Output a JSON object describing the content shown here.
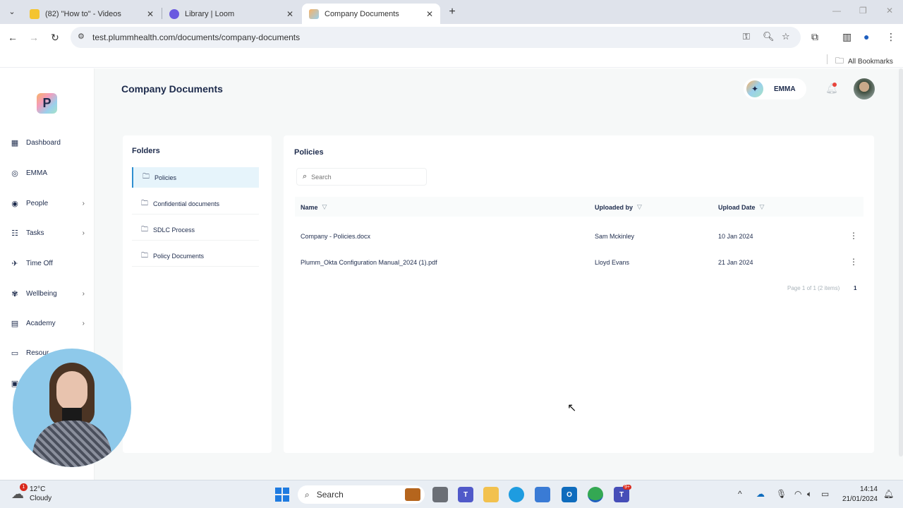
{
  "browser": {
    "tabs": [
      {
        "title": "(82) \"How to\" - Videos"
      },
      {
        "title": "Library | Loom"
      },
      {
        "title": "Company Documents"
      }
    ],
    "url": "test.plummhealth.com/documents/company-documents",
    "bookmarks_label": "All Bookmarks"
  },
  "sidebar": {
    "logo": "P",
    "items": [
      {
        "label": "Dashboard",
        "icon": "dashboard-icon"
      },
      {
        "label": "EMMA",
        "icon": "emma-icon"
      },
      {
        "label": "People",
        "icon": "people-icon"
      },
      {
        "label": "Tasks",
        "icon": "tasks-icon"
      },
      {
        "label": "Time Off",
        "icon": "plane-icon"
      },
      {
        "label": "Wellbeing",
        "icon": "wellbeing-icon"
      },
      {
        "label": "Academy",
        "icon": "academy-icon"
      },
      {
        "label": "Resour",
        "icon": "resources-icon"
      }
    ]
  },
  "header": {
    "title": "Company Documents",
    "assistant_label": "EMMA"
  },
  "folders": {
    "heading": "Folders",
    "items": [
      {
        "label": "Policies"
      },
      {
        "label": "Confidential documents"
      },
      {
        "label": "SDLC Process"
      },
      {
        "label": "Policy Documents"
      }
    ]
  },
  "documents": {
    "heading": "Policies",
    "search_placeholder": "Search",
    "columns": {
      "name": "Name",
      "uploaded_by": "Uploaded by",
      "upload_date": "Upload Date"
    },
    "rows": [
      {
        "name": "Company - Policies.docx",
        "uploaded_by": "Sam Mckinley",
        "upload_date": "10 Jan 2024"
      },
      {
        "name": "Plumm_Okta Configuration Manual_2024 (1).pdf",
        "uploaded_by": "Lloyd Evans",
        "upload_date": "21 Jan 2024"
      }
    ],
    "pagination_text": "Page 1 of 1 (2 items)",
    "current_page": "1"
  },
  "taskbar": {
    "weather_temp": "12°C",
    "weather_desc": "Cloudy",
    "weather_badge": "1",
    "search_label": "Search",
    "teams_badge": "9+",
    "time": "14:14",
    "date": "21/01/2024"
  },
  "colors": {
    "accent": "#2f8fd0",
    "text": "#1d2b4c",
    "active_folder_bg": "#e6f4fb"
  }
}
